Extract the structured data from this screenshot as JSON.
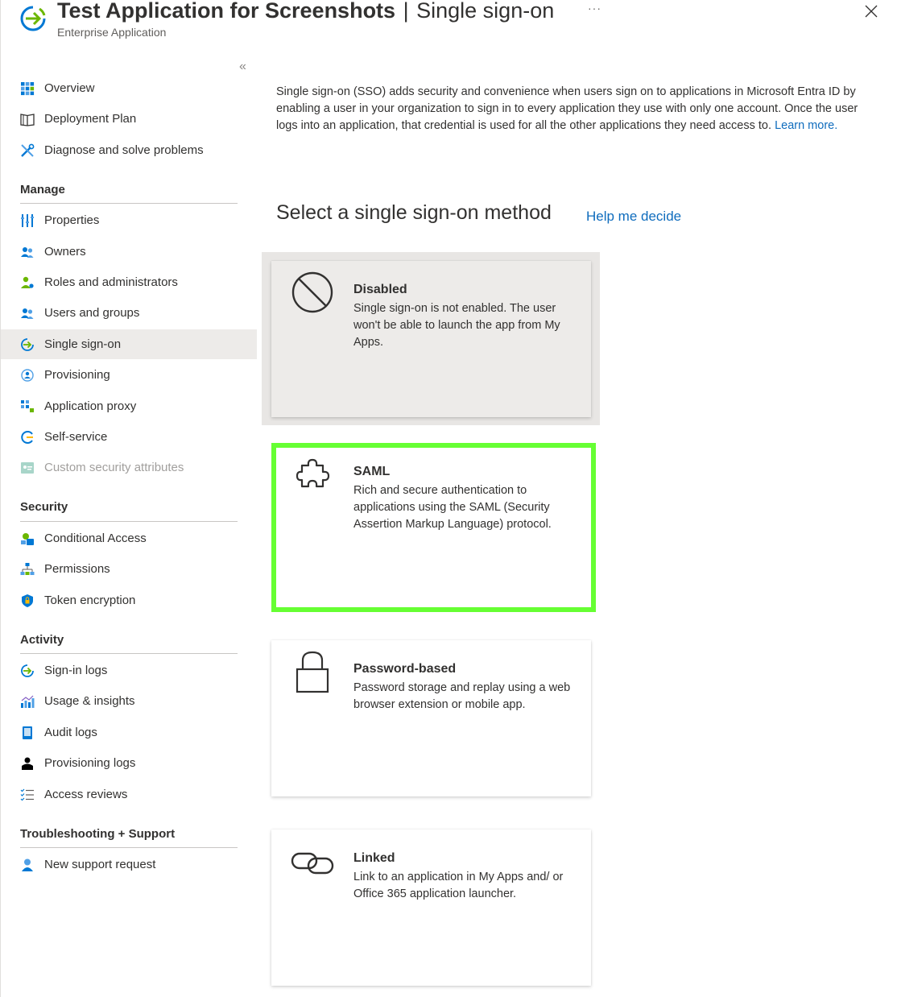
{
  "header": {
    "app_name": "Test Application for Screenshots",
    "separator": "|",
    "page_name": "Single sign-on",
    "subtitle": "Enterprise Application",
    "more_label": "···"
  },
  "sidebar": {
    "collapse_label": "«",
    "top_items": [
      {
        "label": "Overview",
        "icon": "overview-grid-icon"
      },
      {
        "label": "Deployment Plan",
        "icon": "book-icon"
      },
      {
        "label": "Diagnose and solve problems",
        "icon": "wrench-icon"
      }
    ],
    "sections": [
      {
        "title": "Manage",
        "items": [
          {
            "label": "Properties",
            "icon": "properties-icon"
          },
          {
            "label": "Owners",
            "icon": "owners-icon"
          },
          {
            "label": "Roles and administrators",
            "icon": "roles-icon"
          },
          {
            "label": "Users and groups",
            "icon": "users-groups-icon"
          },
          {
            "label": "Single sign-on",
            "icon": "sso-icon",
            "active": true
          },
          {
            "label": "Provisioning",
            "icon": "provisioning-icon"
          },
          {
            "label": "Application proxy",
            "icon": "app-proxy-icon"
          },
          {
            "label": "Self-service",
            "icon": "self-service-icon"
          },
          {
            "label": "Custom security attributes",
            "icon": "custom-attributes-icon",
            "disabled": true
          }
        ]
      },
      {
        "title": "Security",
        "items": [
          {
            "label": "Conditional Access",
            "icon": "conditional-access-icon"
          },
          {
            "label": "Permissions",
            "icon": "permissions-icon"
          },
          {
            "label": "Token encryption",
            "icon": "shield-icon"
          }
        ]
      },
      {
        "title": "Activity",
        "items": [
          {
            "label": "Sign-in logs",
            "icon": "sign-in-logs-icon"
          },
          {
            "label": "Usage & insights",
            "icon": "usage-insights-icon"
          },
          {
            "label": "Audit logs",
            "icon": "audit-logs-icon"
          },
          {
            "label": "Provisioning logs",
            "icon": "provisioning-logs-icon"
          },
          {
            "label": "Access reviews",
            "icon": "access-reviews-icon"
          }
        ]
      },
      {
        "title": "Troubleshooting + Support",
        "items": [
          {
            "label": "New support request",
            "icon": "support-person-icon"
          }
        ]
      }
    ]
  },
  "main": {
    "intro_text": "Single sign-on (SSO) adds security and convenience when users sign on to applications in Microsoft Entra ID by enabling a user in your organization to sign in to every application they use with only one account. Once the user logs into an application, that credential is used for all the other applications they need access to.",
    "learn_more": "Learn more.",
    "method_heading": "Select a single sign-on method",
    "help_link": "Help me decide",
    "methods": [
      {
        "title": "Disabled",
        "description": "Single sign-on is not enabled. The user won't be able to launch the app from My Apps.",
        "icon": "prohibited-icon"
      },
      {
        "title": "SAML",
        "description": "Rich and secure authentication to applications using the SAML (Security Assertion Markup Language) protocol.",
        "icon": "puzzle-icon",
        "highlight_color": "#66ff33"
      },
      {
        "title": "Password-based",
        "description": "Password storage and replay using a web browser extension or mobile app.",
        "icon": "lock-icon"
      },
      {
        "title": "Linked",
        "description": "Link to an application in My Apps and/ or Office 365 application launcher.",
        "icon": "link-icon"
      }
    ]
  },
  "colors": {
    "link": "#0f6cbd",
    "active_nav_bg": "#edebe9",
    "highlight": "#66ff33"
  }
}
